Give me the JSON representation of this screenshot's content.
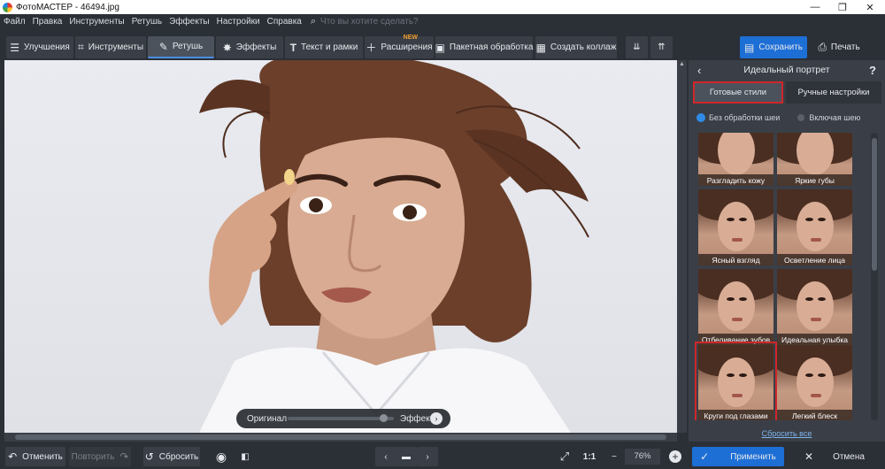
{
  "window": {
    "title": "ФотоМАСТЕР - 46494.jpg",
    "controls": [
      "—",
      "❐",
      "✕"
    ]
  },
  "menu": {
    "items": [
      "Файл",
      "Правка",
      "Инструменты",
      "Ретушь",
      "Эффекты",
      "Настройки",
      "Справка"
    ],
    "search_placeholder": "Что вы хотите сделать?"
  },
  "toolbar": {
    "tabs": [
      {
        "label": "Улучшения",
        "icon": "sliders-icon"
      },
      {
        "label": "Инструменты",
        "icon": "crop-icon"
      },
      {
        "label": "Ретушь",
        "icon": "brush-icon"
      },
      {
        "label": "Эффекты",
        "icon": "sparkle-icon"
      },
      {
        "label": "Текст и рамки",
        "icon": "text-icon"
      },
      {
        "label": "Расширения",
        "icon": "plus-icon"
      },
      {
        "label": "Пакетная обработка",
        "icon": "image-icon"
      },
      {
        "label": "Создать коллаж",
        "icon": "collage-icon"
      }
    ],
    "new_badge": "NEW",
    "save_label": "Сохранить",
    "print_label": "Печать"
  },
  "compare": {
    "original_label": "Оригинал",
    "effect_label": "Эффект",
    "position": 0.9
  },
  "panel": {
    "title": "Идеальный портрет",
    "help": "?",
    "tab_ready": "Готовые стили",
    "tab_manual": "Ручные настройки",
    "radio_no_neck": "Без обработки шеи",
    "radio_with_neck": "Включая шею",
    "presets": [
      "Разгладить кожу",
      "Яркие губы",
      "Ясный взгляд",
      "Осветление лица",
      "Отбеливание зубов",
      "Идеальная улыбка",
      "Круги под глазами",
      "Легкий блеск"
    ],
    "reset_all": "Сбросить все"
  },
  "bottom": {
    "undo_label": "Отменить",
    "redo_label": "Повторить",
    "reset_label": "Сбросить",
    "ratio_label": "1:1",
    "zoom_value": "76%",
    "apply_label": "Применить",
    "cancel_label": "Отмена"
  },
  "colors": {
    "accent": "#1d6fd6",
    "highlight": "#d0262a",
    "panel_bg": "#3a3f47",
    "app_bg": "#2b2f36"
  }
}
